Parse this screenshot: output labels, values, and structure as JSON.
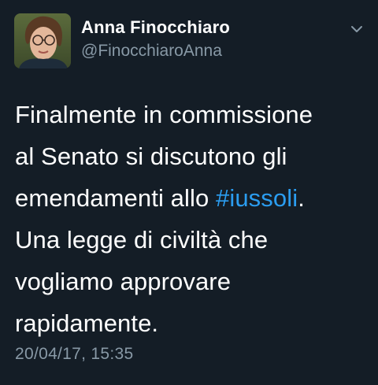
{
  "tweet": {
    "author": {
      "display_name": "Anna Finocchiaro",
      "handle": "@FinocchiaroAnna"
    },
    "text": {
      "line1": "Finalmente in commissione",
      "line2": "al Senato si discutono gli",
      "line3_prefix": "emendamenti allo ",
      "line3_hashtag": "#iussoli",
      "line3_suffix": ".",
      "line4": "Una legge di civiltà che",
      "line5": "vogliamo approvare",
      "line6": "rapidamente."
    },
    "timestamp": "20/04/17, 15:35",
    "icons": {
      "menu": "chevron-down-icon"
    }
  },
  "colors": {
    "background": "#141d26",
    "text": "#ffffff",
    "secondary": "#8899a6",
    "link": "#2b9df0"
  }
}
